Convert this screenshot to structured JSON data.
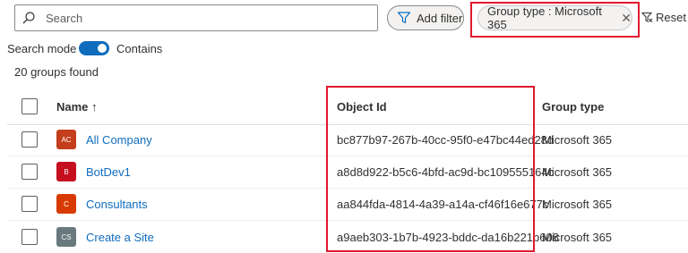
{
  "search": {
    "placeholder": "Search",
    "value": ""
  },
  "toolbar": {
    "add_filter_label": "Add filter",
    "active_filter_label": "Group type : Microsoft 365",
    "active_filter_close": "✕",
    "reset_label": "Reset filters"
  },
  "search_mode": {
    "label": "Search mode",
    "toggle_on": true,
    "toggle_label": "Contains"
  },
  "results_count": "20 groups found",
  "table": {
    "columns": {
      "name": "Name ↑",
      "object_id": "Object Id",
      "group_type": "Group type"
    },
    "rows": [
      {
        "initials": "AC",
        "avatar_color": "#c43e1c",
        "name": "All Company",
        "object_id": "bc877b97-267b-40cc-95f0-e47bc44ed28d",
        "group_type": "Microsoft 365"
      },
      {
        "initials": "B",
        "avatar_color": "#c50f1f",
        "name": "BotDev1",
        "object_id": "a8d8d922-b5c6-4bfd-ac9d-bc109555164c",
        "group_type": "Microsoft 365"
      },
      {
        "initials": "C",
        "avatar_color": "#d83b01",
        "name": "Consultants",
        "object_id": "aa844fda-4814-4a39-a14a-cf46f16e677c",
        "group_type": "Microsoft 365"
      },
      {
        "initials": "CS",
        "avatar_color": "#69797e",
        "name": "Create a Site",
        "object_id": "a9aeb303-1b7b-4923-bddc-da16b221b608",
        "group_type": "Microsoft 365"
      }
    ]
  },
  "colors": {
    "accent": "#0f6cbd",
    "highlight": "#e0182d"
  },
  "icons": {
    "search": "search-icon",
    "filter": "funnel-icon",
    "reset": "funnel-clear-icon"
  }
}
